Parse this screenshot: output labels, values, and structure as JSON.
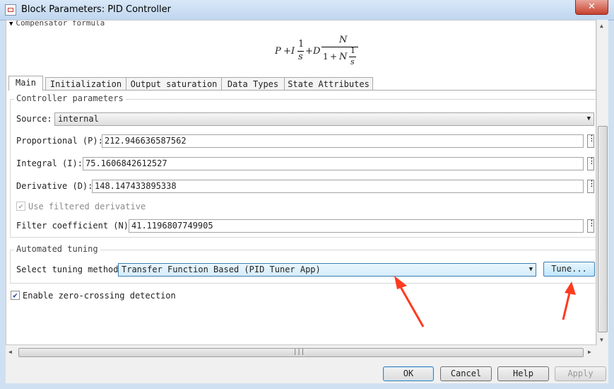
{
  "window": {
    "title": "Block Parameters: PID Controller",
    "close_glyph": "✕"
  },
  "formula": {
    "header": "Compensator formula",
    "p": "P",
    "plus1": "+",
    "i": "I",
    "one1": "1",
    "s1": "s",
    "plus2": "+",
    "d": "D",
    "n_top": "N",
    "den_one": "1",
    "den_plus": "+",
    "n_den": "N",
    "one2": "1",
    "s2": "s"
  },
  "tabs": [
    "Main",
    "Initialization",
    "Output saturation",
    "Data Types",
    "State Attributes"
  ],
  "controller_parameters": {
    "title": "Controller parameters",
    "source_label": "Source:",
    "source_value": "internal",
    "proportional_label": "Proportional (P):",
    "proportional_value": "212.946636587562",
    "integral_label": "Integral (I):",
    "integral_value": "75.1606842612527",
    "derivative_label": "Derivative (D):",
    "derivative_value": "148.147433895338",
    "filtered_label": "Use filtered derivative",
    "filtered_checked": true,
    "filter_label": "Filter coefficient (N):",
    "filter_value": "41.1196807749905"
  },
  "automated_tuning": {
    "title": "Automated tuning",
    "method_label": "Select tuning method:",
    "method_value": "Transfer Function Based (PID Tuner App)",
    "tune_label": "Tune..."
  },
  "zero_crossing": {
    "label": "Enable zero-crossing detection",
    "checked": true
  },
  "buttons": {
    "ok": "OK",
    "cancel": "Cancel",
    "help": "Help",
    "apply": "Apply"
  },
  "colors": {
    "annotation_arrow": "#ff3b1f",
    "accent": "#3c7fb1"
  },
  "icons": {
    "dropdown": "▼",
    "check": "✔",
    "ellipsis": "⋮",
    "grip": "|||"
  }
}
